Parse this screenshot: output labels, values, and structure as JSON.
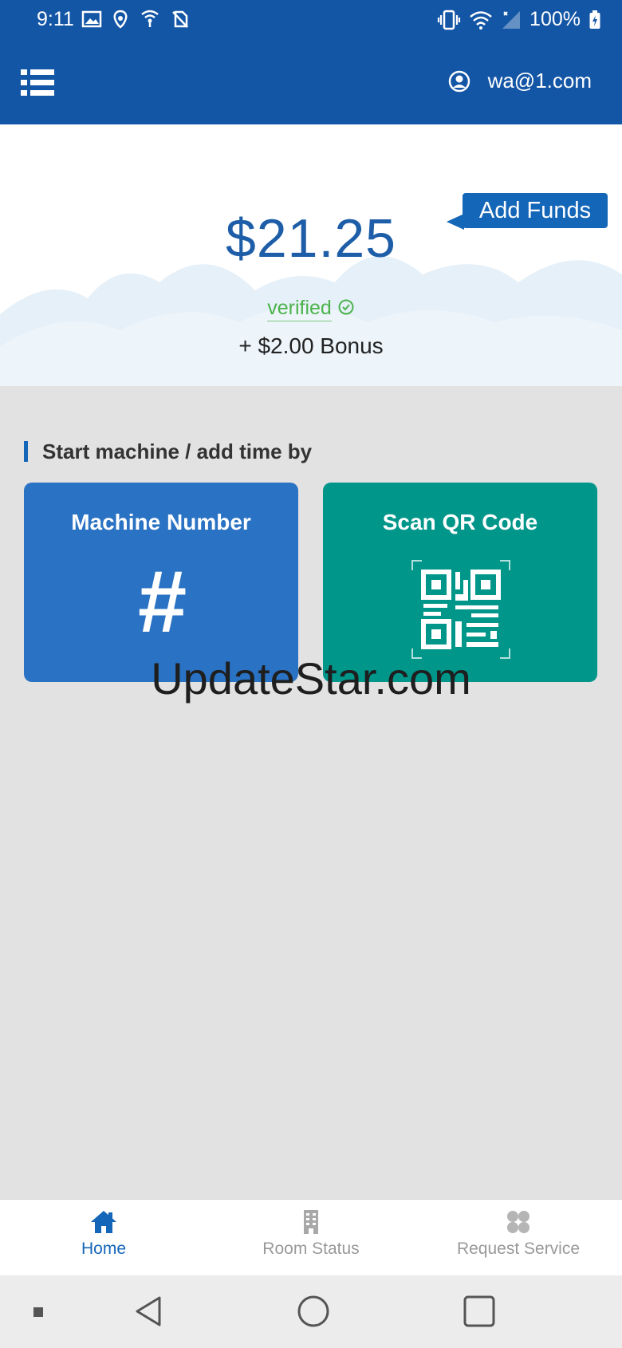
{
  "status_bar": {
    "time": "9:11",
    "battery": "100%"
  },
  "app_bar": {
    "account_email": "wa@1.com"
  },
  "balance": {
    "amount": "$21.25",
    "add_funds_label": "Add Funds",
    "verified_label": "verified",
    "bonus_text": "+ $2.00 Bonus"
  },
  "start_section": {
    "title": "Start machine / add time by",
    "tiles": [
      {
        "label": "Machine Number",
        "glyph": "#"
      },
      {
        "label": "Scan QR Code"
      }
    ]
  },
  "watermark": "UpdateStar.com",
  "bottom_nav": [
    {
      "label": "Home",
      "icon": "home-icon",
      "active": true
    },
    {
      "label": "Room Status",
      "icon": "building-icon",
      "active": false
    },
    {
      "label": "Request Service",
      "icon": "service-grid-icon",
      "active": false
    }
  ],
  "colors": {
    "app_bar": "#1456a6",
    "accent": "#1466b8",
    "machine_tile": "#2a72c3",
    "qr_tile": "#00968a",
    "verified": "#4bb34b"
  }
}
